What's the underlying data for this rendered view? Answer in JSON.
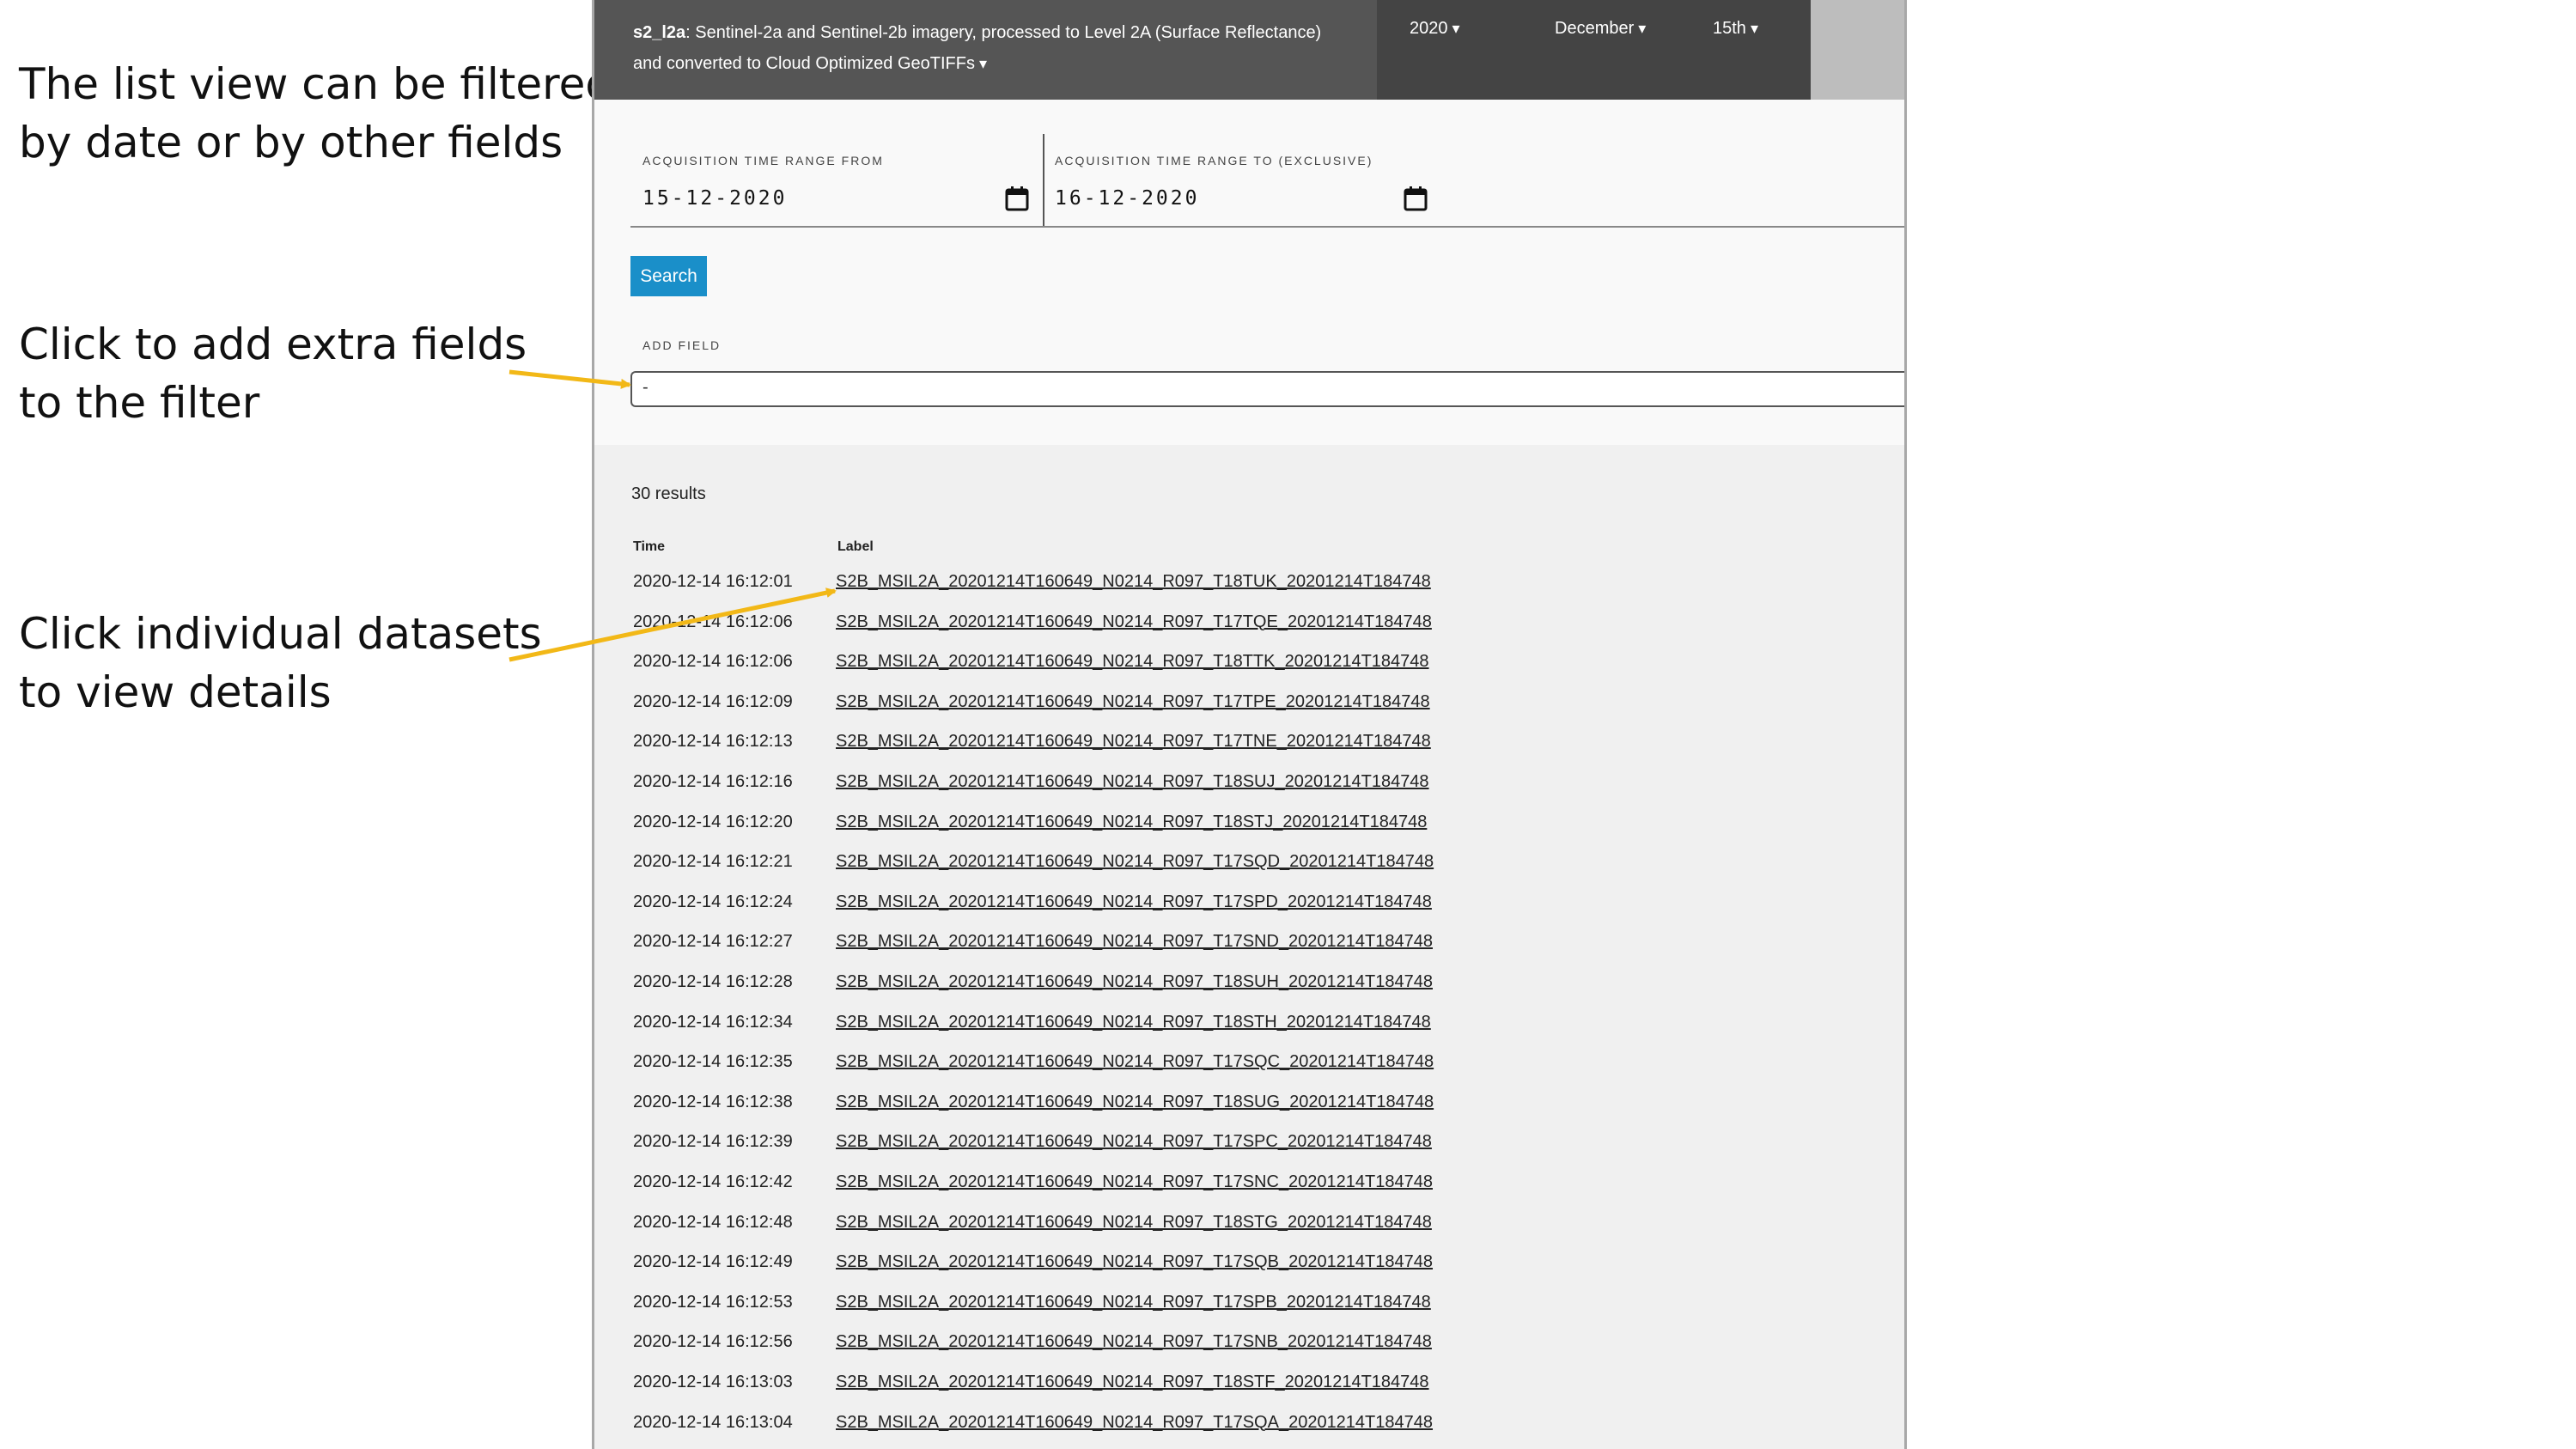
{
  "annotations": {
    "filter_note": [
      "The list view can be filtered",
      "by date or by other fields"
    ],
    "add_field_note": [
      "Click to add extra fields",
      "to the filter"
    ],
    "datasets_note": [
      "Click individual datasets",
      "to view details"
    ]
  },
  "colors": {
    "arrow": "#f2b817",
    "header_dark": "#555555",
    "header_darker": "#444444",
    "search_button": "#1a8fc9"
  },
  "header": {
    "product_name": "s2_l2a",
    "product_desc_line1": ": Sentinel-2a and Sentinel-2b imagery, processed to Level 2A (Surface Reflectance)",
    "product_desc_line2": "and converted to Cloud Optimized GeoTIFFs",
    "year": "2020",
    "month": "December",
    "day": "15th"
  },
  "filter": {
    "from_label": "ACQUISITION TIME RANGE FROM",
    "from_value": "15-12-2020",
    "to_label": "ACQUISITION TIME RANGE TO (EXCLUSIVE)",
    "to_value": "16-12-2020",
    "search_label": "Search",
    "add_field_label": "ADD FIELD",
    "add_field_value": "-",
    "icons": {
      "calendar": "calendar-icon"
    }
  },
  "results": {
    "count_text": "30 results",
    "columns": [
      "Time",
      "Label"
    ],
    "rows": [
      {
        "time": "2020-12-14 16:12:01",
        "label": "S2B_MSIL2A_20201214T160649_N0214_R097_T18TUK_20201214T184748"
      },
      {
        "time": "2020-12-14 16:12:06",
        "label": "S2B_MSIL2A_20201214T160649_N0214_R097_T17TQE_20201214T184748"
      },
      {
        "time": "2020-12-14 16:12:06",
        "label": "S2B_MSIL2A_20201214T160649_N0214_R097_T18TTK_20201214T184748"
      },
      {
        "time": "2020-12-14 16:12:09",
        "label": "S2B_MSIL2A_20201214T160649_N0214_R097_T17TPE_20201214T184748"
      },
      {
        "time": "2020-12-14 16:12:13",
        "label": "S2B_MSIL2A_20201214T160649_N0214_R097_T17TNE_20201214T184748"
      },
      {
        "time": "2020-12-14 16:12:16",
        "label": "S2B_MSIL2A_20201214T160649_N0214_R097_T18SUJ_20201214T184748"
      },
      {
        "time": "2020-12-14 16:12:20",
        "label": "S2B_MSIL2A_20201214T160649_N0214_R097_T18STJ_20201214T184748"
      },
      {
        "time": "2020-12-14 16:12:21",
        "label": "S2B_MSIL2A_20201214T160649_N0214_R097_T17SQD_20201214T184748"
      },
      {
        "time": "2020-12-14 16:12:24",
        "label": "S2B_MSIL2A_20201214T160649_N0214_R097_T17SPD_20201214T184748"
      },
      {
        "time": "2020-12-14 16:12:27",
        "label": "S2B_MSIL2A_20201214T160649_N0214_R097_T17SND_20201214T184748"
      },
      {
        "time": "2020-12-14 16:12:28",
        "label": "S2B_MSIL2A_20201214T160649_N0214_R097_T18SUH_20201214T184748"
      },
      {
        "time": "2020-12-14 16:12:34",
        "label": "S2B_MSIL2A_20201214T160649_N0214_R097_T18STH_20201214T184748"
      },
      {
        "time": "2020-12-14 16:12:35",
        "label": "S2B_MSIL2A_20201214T160649_N0214_R097_T17SQC_20201214T184748"
      },
      {
        "time": "2020-12-14 16:12:38",
        "label": "S2B_MSIL2A_20201214T160649_N0214_R097_T18SUG_20201214T184748"
      },
      {
        "time": "2020-12-14 16:12:39",
        "label": "S2B_MSIL2A_20201214T160649_N0214_R097_T17SPC_20201214T184748"
      },
      {
        "time": "2020-12-14 16:12:42",
        "label": "S2B_MSIL2A_20201214T160649_N0214_R097_T17SNC_20201214T184748"
      },
      {
        "time": "2020-12-14 16:12:48",
        "label": "S2B_MSIL2A_20201214T160649_N0214_R097_T18STG_20201214T184748"
      },
      {
        "time": "2020-12-14 16:12:49",
        "label": "S2B_MSIL2A_20201214T160649_N0214_R097_T17SQB_20201214T184748"
      },
      {
        "time": "2020-12-14 16:12:53",
        "label": "S2B_MSIL2A_20201214T160649_N0214_R097_T17SPB_20201214T184748"
      },
      {
        "time": "2020-12-14 16:12:56",
        "label": "S2B_MSIL2A_20201214T160649_N0214_R097_T17SNB_20201214T184748"
      },
      {
        "time": "2020-12-14 16:13:03",
        "label": "S2B_MSIL2A_20201214T160649_N0214_R097_T18STF_20201214T184748"
      },
      {
        "time": "2020-12-14 16:13:04",
        "label": "S2B_MSIL2A_20201214T160649_N0214_R097_T17SQA_20201214T184748"
      }
    ]
  }
}
